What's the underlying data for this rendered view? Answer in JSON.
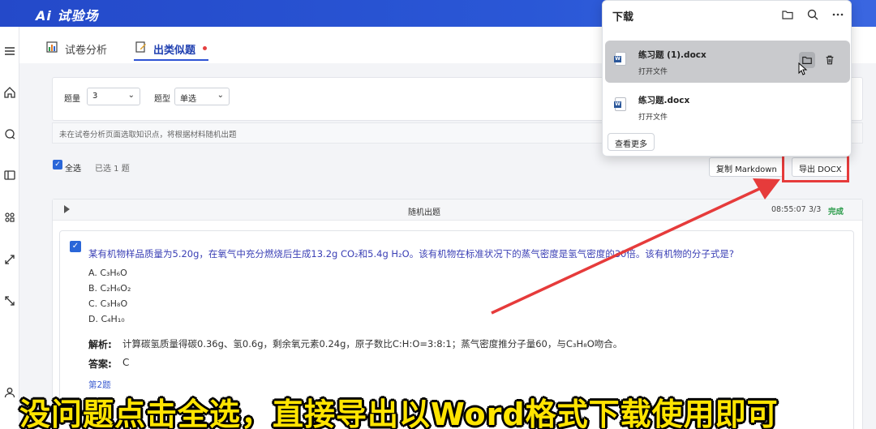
{
  "app": {
    "logo": "Ai 试验场"
  },
  "tabs": [
    {
      "label": "试卷分析"
    },
    {
      "label": "出类似题"
    }
  ],
  "filters": {
    "count_label": "题量",
    "count_value": "3",
    "type_label": "题型",
    "type_value": "单选"
  },
  "hint": "未在试卷分析页面选取知识点，将根据材料随机出题",
  "selection": {
    "select_all": "全选",
    "selected_count": "已选 1 题"
  },
  "actions": {
    "copy_markdown": "复制 Markdown",
    "export_docx": "导出 DOCX"
  },
  "result": {
    "title": "随机出题",
    "time": "08:55:07",
    "progress": "3/3",
    "status": "完成"
  },
  "question": {
    "stem": "某有机物样品质量为5.20g，在氧气中充分燃烧后生成13.2g CO₂和5.4g H₂O。该有机物在标准状况下的蒸气密度是氢气密度的30倍。该有机物的分子式是?",
    "options": [
      "A. C₃H₆O",
      "B. C₂H₆O₂",
      "C. C₃H₈O",
      "D. C₄H₁₀"
    ],
    "analysis_label": "解析:",
    "analysis": "计算碳氢质量得碳0.36g、氢0.6g，剩余氧元素0.24g，原子数比C:H:O=3:8:1；蒸气密度推分子量60，与C₃H₈O吻合。",
    "answer_label": "答案:",
    "answer": "C",
    "next_link": "第2题"
  },
  "downloads": {
    "title": "下载",
    "items": [
      {
        "name": "练习题 (1).docx",
        "action": "打开文件"
      },
      {
        "name": "练习题.docx",
        "action": "打开文件"
      }
    ],
    "more": "查看更多"
  },
  "subtitle": "没问题点击全选，直接导出以Word格式下载使用即可",
  "colors": {
    "brand": "#2449c9",
    "annotation": "#e63b3b",
    "subtitle": "#ffe400"
  }
}
